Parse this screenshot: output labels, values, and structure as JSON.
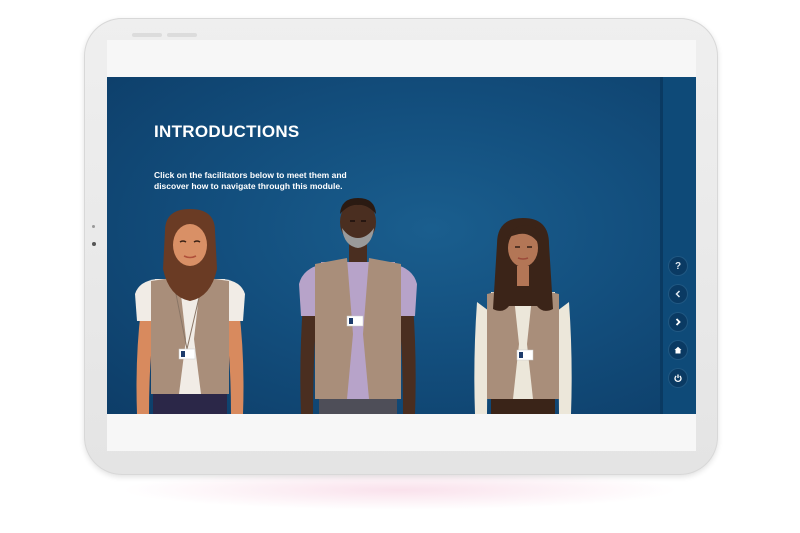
{
  "page": {
    "title": "INTRODUCTIONS",
    "instructions": "Click on the facilitators below to meet them and discover how to navigate through this module."
  },
  "facilitators": [
    {
      "icon": "facilitator-hijab-illustration"
    },
    {
      "icon": "facilitator-older-man-illustration"
    },
    {
      "icon": "facilitator-long-hair-illustration"
    }
  ],
  "nav": {
    "buttons": [
      {
        "icon": "help-icon",
        "glyph": "?"
      },
      {
        "icon": "back-icon"
      },
      {
        "icon": "next-icon"
      },
      {
        "icon": "home-icon"
      },
      {
        "icon": "power-icon"
      }
    ]
  },
  "colors": {
    "background": "#134f7e",
    "rail": "#0e4a78",
    "vest": "#a98e7a",
    "text": "#ffffff"
  }
}
